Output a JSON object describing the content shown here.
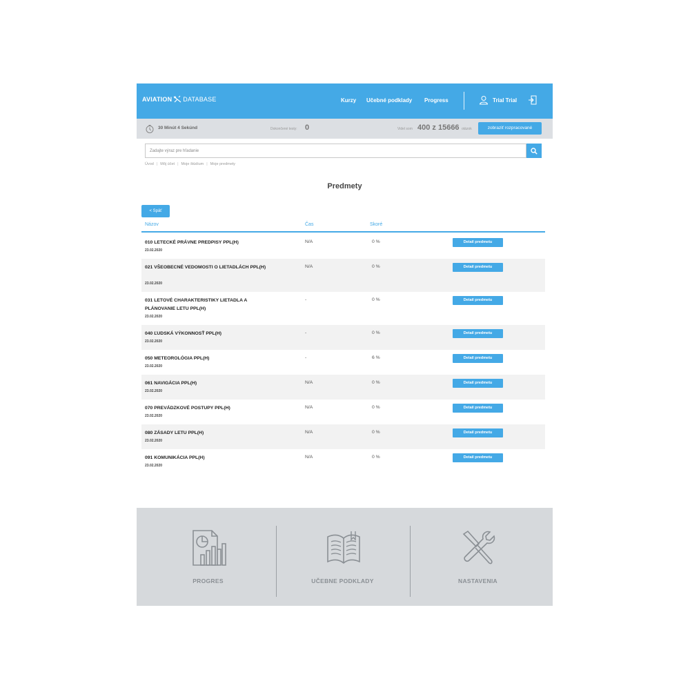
{
  "header": {
    "logo_part1": "AVIATION",
    "logo_part2": "DATABASE",
    "nav": [
      "Kurzy",
      "Učebné podklady",
      "Progress"
    ],
    "user": "Trial Trial",
    "icons": {
      "user": "user-icon",
      "logout": "logout-icon",
      "logo": "plane-icon"
    }
  },
  "infobar": {
    "timer": "30 Minút 4 Sekúnd",
    "done_label": "Dokončené testy:",
    "done_value": "0",
    "seen_label": "Videl som",
    "seen_value": "400 z 15666",
    "seen_suffix": "otázok",
    "processed_button": "zobraziť rozpracované"
  },
  "search": {
    "placeholder": "Zadajte výraz pre hľadanie"
  },
  "breadcrumb": [
    "Úvod",
    "Môj účet",
    "Moje štúdium",
    "Moje predmety"
  ],
  "page_title": "Predmety",
  "back_button": "< Späť",
  "table": {
    "columns": [
      "Názov",
      "Čas",
      "Skoré"
    ],
    "detail_label": "Detail predmetu",
    "rows": [
      {
        "name": "010 LETECKÉ PRÁVNE PREDPISY PPL(H)",
        "date": "23.02.2020",
        "time": "N/A",
        "score": "0 %"
      },
      {
        "name": "021 VŠEOBECNÉ VEDOMOSTI O LIETADLÁCH PPL(H)",
        "date": "23.02.2020",
        "time": "N/A",
        "score": "0 %"
      },
      {
        "name": "031 LETOVÉ CHARAKTERISTIKY LIETADLA A PLÁNOVANIE LETU PPL(H)",
        "date": "23.02.2020",
        "time": "-",
        "score": "0 %"
      },
      {
        "name": "040 ĽUDSKÁ VÝKONNOSŤ PPL(H)",
        "date": "23.02.2020",
        "time": "-",
        "score": "0 %"
      },
      {
        "name": "050 METEOROLÓGIA PPL(H)",
        "date": "23.02.2020",
        "time": "-",
        "score": "6 %"
      },
      {
        "name": "061 NAVIGÁCIA PPL(H)",
        "date": "23.02.2020",
        "time": "N/A",
        "score": "0 %"
      },
      {
        "name": "070 PREVÁDZKOVÉ POSTUPY PPL(H)",
        "date": "23.02.2020",
        "time": "N/A",
        "score": "0 %"
      },
      {
        "name": "080 ZÁSADY LETU PPL(H)",
        "date": "23.02.2020",
        "time": "N/A",
        "score": "0 %"
      },
      {
        "name": "091 KOMUNIKÁCIA PPL(H)",
        "date": "23.02.2020",
        "time": "N/A",
        "score": "0 %"
      }
    ]
  },
  "footer": [
    {
      "label": "PROGRES",
      "icon": "report-chart-icon"
    },
    {
      "label": "UČEBNE PODKLADY",
      "icon": "book-icon"
    },
    {
      "label": "NASTAVENIA",
      "icon": "tools-icon"
    }
  ],
  "colors": {
    "accent": "#44a9e6",
    "infobar": "#dcdfe3",
    "footer": "#d6d9dc",
    "row_alt": "#f2f2f2"
  }
}
